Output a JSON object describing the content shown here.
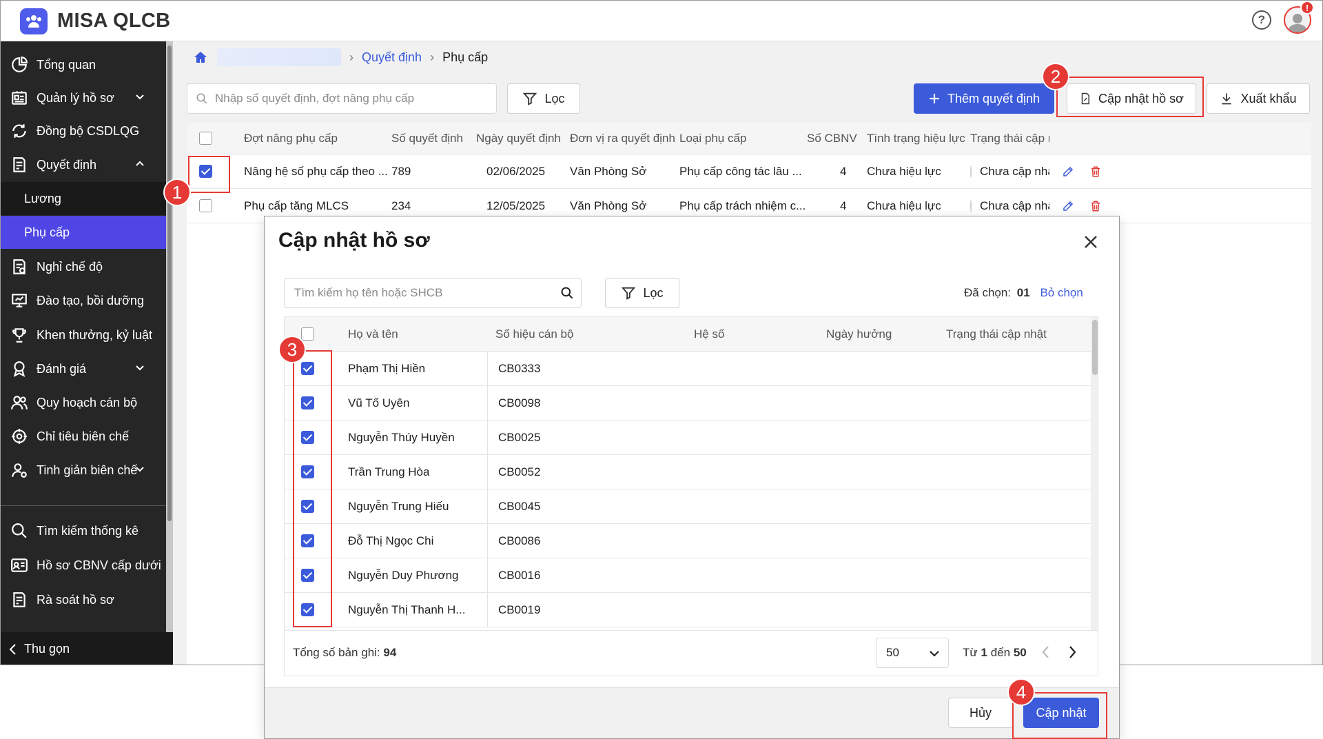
{
  "app": {
    "title": "MISA QLCB",
    "help_icon": "question-circle-icon",
    "notification_count": "!"
  },
  "sidebar": {
    "items": [
      {
        "label": "Tổng quan",
        "icon": "pie-chart-icon"
      },
      {
        "label": "Quản lý hồ sơ",
        "icon": "profile-card-icon"
      },
      {
        "label": "Đồng bộ CSDLQG",
        "icon": "sync-icon"
      },
      {
        "label": "Quyết định",
        "icon": "document-icon"
      },
      {
        "label": "Nghỉ chế độ",
        "icon": "leave-document-icon"
      },
      {
        "label": "Đào tạo, bồi dưỡng",
        "icon": "training-board-icon"
      },
      {
        "label": "Khen thưởng, kỷ luật",
        "icon": "trophy-icon"
      },
      {
        "label": "Đánh giá",
        "icon": "award-icon"
      },
      {
        "label": "Quy hoạch cán bộ",
        "icon": "users-icon"
      },
      {
        "label": "Chỉ tiêu biên chế",
        "icon": "target-icon"
      },
      {
        "label": "Tinh giản biên chế",
        "icon": "user-reduce-icon"
      },
      {
        "label": "Tìm kiếm thống kê",
        "icon": "search-icon"
      },
      {
        "label": "Hồ sơ CBNV cấp dưới",
        "icon": "id-card-icon"
      },
      {
        "label": "Rà soát hồ sơ",
        "icon": "review-document-icon"
      }
    ],
    "sub_items": [
      {
        "label": "Lương"
      },
      {
        "label": "Phụ cấp"
      }
    ],
    "collapse_label": "Thu gọn"
  },
  "breadcrumb": {
    "level1": "Quyết định",
    "level2": "Phụ cấp"
  },
  "toolbar": {
    "search_placeholder": "Nhập số quyết định, đợt nâng phụ cấp",
    "filter_label": "Lọc",
    "add_label": "Thêm quyết định",
    "update_label": "Cập nhật hồ sơ",
    "export_label": "Xuất khẩu"
  },
  "table": {
    "columns": [
      "Đợt nâng phụ cấp",
      "Số quyết định",
      "Ngày quyết định",
      "Đơn vị ra quyết định",
      "Loại phụ cấp",
      "Số CBNV",
      "Tình trạng hiệu lực",
      "Trạng thái cập nh"
    ],
    "rows": [
      {
        "checked": true,
        "name": "Nâng hệ số phụ cấp theo ...",
        "decision_no": "789",
        "date": "02/06/2025",
        "unit": "Văn Phòng Sở",
        "type": "Phụ cấp công tác lâu ...",
        "count": "4",
        "validity": "Chưa hiệu lực",
        "status": "Chưa cập nhậ"
      },
      {
        "checked": false,
        "name": "Phụ cấp tăng MLCS",
        "decision_no": "234",
        "date": "12/05/2025",
        "unit": "Văn Phòng Sở",
        "type": "Phụ cấp trách nhiệm c...",
        "count": "4",
        "validity": "Chưa hiệu lực",
        "status": "Chưa cập nhậ"
      }
    ]
  },
  "annotations": {
    "n1": "1",
    "n2": "2",
    "n3": "3",
    "n4": "4"
  },
  "modal": {
    "title": "Cập nhật hồ sơ",
    "search_placeholder": "Tìm kiếm họ tên hoặc SHCB",
    "filter_label": "Lọc",
    "selected_label": "Đã chọn:",
    "selected_count": "01",
    "deselect_label": "Bỏ chọn",
    "columns": [
      "Họ và tên",
      "Số hiệu cán bộ",
      "Hệ số",
      "Ngày hưởng",
      "Trạng thái cập nhật"
    ],
    "rows": [
      {
        "name": "Phạm Thị Hiền",
        "code": "CB0333"
      },
      {
        "name": "Vũ Tố Uyên",
        "code": "CB0098"
      },
      {
        "name": "Nguyễn Thúy Huyền",
        "code": "CB0025"
      },
      {
        "name": "Trần Trung Hòa",
        "code": "CB0052"
      },
      {
        "name": "Nguyễn Trung Hiếu",
        "code": "CB0045"
      },
      {
        "name": "Đỗ Thị Ngọc Chi",
        "code": "CB0086"
      },
      {
        "name": "Nguyễn Duy Phương",
        "code": "CB0016"
      },
      {
        "name": "Nguyễn Thị Thanh H...",
        "code": "CB0019"
      }
    ],
    "total_label": "Tổng số bản ghi:",
    "total_count": "94",
    "page_size": "50",
    "range_from_label": "Từ",
    "range_from": "1",
    "range_to_label": "đến",
    "range_to": "50",
    "cancel_label": "Hủy",
    "submit_label": "Cập nhật"
  },
  "colors": {
    "primary": "#3b5bdb",
    "sidebar_bg": "#262626",
    "active_nav": "#4f46e5",
    "annotation": "#e53935"
  }
}
